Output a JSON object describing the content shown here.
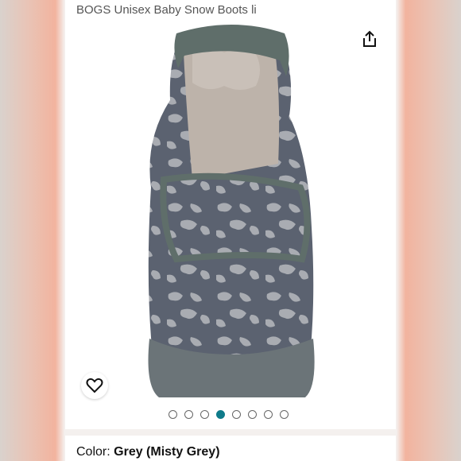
{
  "product": {
    "title": "BOGS Unisex Baby Snow Boots li"
  },
  "gallery": {
    "image_alt": "Grey leopard print baby snow boot, rear view",
    "image_count": 8,
    "active_index": 3
  },
  "actions": {
    "share_icon": "share-icon",
    "wishlist_icon": "heart-icon"
  },
  "color": {
    "label": "Color:",
    "value": "Grey (Misty Grey)"
  },
  "colors": {
    "accent": "#0f7b8a",
    "boot_body": "#5b6270",
    "boot_trim": "#5f6e6a",
    "pattern": "#a9acb2",
    "lining": "#bdb3aa"
  }
}
